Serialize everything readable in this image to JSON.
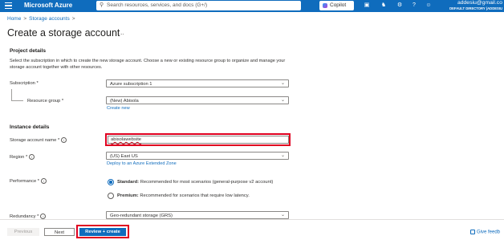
{
  "topbar": {
    "brand": "Microsoft Azure",
    "search_placeholder": "Search resources, services, and docs (G+/)",
    "copilot_label": "Copilot",
    "account_email": "addesiu@gmail.co",
    "account_directory": "DEFAULT DIRECTORY (ADDESIU"
  },
  "breadcrumb": {
    "home": "Home",
    "storage": "Storage accounts",
    "sep": ">"
  },
  "page": {
    "title": "Create a storage account",
    "more": "..."
  },
  "project": {
    "heading": "Project details",
    "description": "Select the subscription in which to create the new storage account. Choose a new or existing resource group to organize and manage your storage account together with other resources.",
    "subscription_label": "Subscription *",
    "subscription_value": "Azure subscription 1",
    "resource_group_label": "Resource group *",
    "resource_group_value": "(New) Abisola",
    "create_new": "Create new"
  },
  "instance": {
    "heading": "Instance details",
    "name_label": "Storage account name *",
    "name_value": "abisolawebsite",
    "region_label": "Region *",
    "region_value": "(US) East US",
    "extended_zone_link": "Deploy to an Azure Extended Zone",
    "performance_label": "Performance *",
    "perf_standard_title": "Standard:",
    "perf_standard_desc": "Recommended for most scenarios (general-purpose v2 account)",
    "perf_premium_title": "Premium:",
    "perf_premium_desc": "Recommended for scenarios that require low latency.",
    "redundancy_label": "Redundancy *",
    "redundancy_value": "Geo-redundant storage (GRS)"
  },
  "footer": {
    "previous": "Previous",
    "next": "Next",
    "review": "Review + create",
    "feedback": "Give feedb"
  },
  "icons": {
    "menu": "menu-icon",
    "search": "search-icon",
    "copilot": "copilot-icon",
    "terminal": "cloud-shell-icon",
    "bell": "notifications-icon",
    "gear": "settings-icon",
    "help": "help-icon",
    "feedback": "feedback-icon",
    "chevron": "chevron-down-icon",
    "info": "info-icon"
  },
  "colors": {
    "accent": "#0f6cbd",
    "highlight": "#e00020"
  }
}
